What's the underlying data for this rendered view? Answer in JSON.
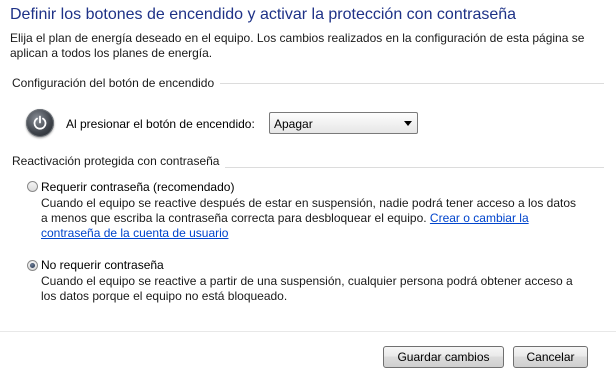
{
  "page": {
    "title": "Definir los botones de encendido y activar la protección con contraseña",
    "intro": "Elija el plan de energía deseado en el equipo. Los cambios realizados en la configuración de esta página se aplican a todos los planes de energía."
  },
  "power_section": {
    "heading": "Configuración del botón de encendido",
    "icon": "power-button-icon",
    "dropdown_label": "Al presionar el botón de encendido:",
    "dropdown_value": "Apagar"
  },
  "wake_section": {
    "heading": "Reactivación protegida con contraseña",
    "options": [
      {
        "label": "Requerir contraseña (recomendado)",
        "selected": false,
        "desc_line1": "Cuando el equipo se reactive después de estar en suspensión, nadie podrá tener acceso a los datos",
        "desc_line2": "a menos que escriba la contraseña correcta para desbloquear el equipo. ",
        "link_part1": "Crear o cambiar la",
        "link_part2": "contraseña de la cuenta de usuario"
      },
      {
        "label": "No requerir contraseña",
        "selected": true,
        "desc_line1": "Cuando el equipo se reactive a partir de una suspensión, cualquier persona podrá obtener acceso a",
        "desc_line2": "los datos porque el equipo no está bloqueado."
      }
    ]
  },
  "buttons": {
    "save": "Guardar cambios",
    "cancel": "Cancelar"
  }
}
